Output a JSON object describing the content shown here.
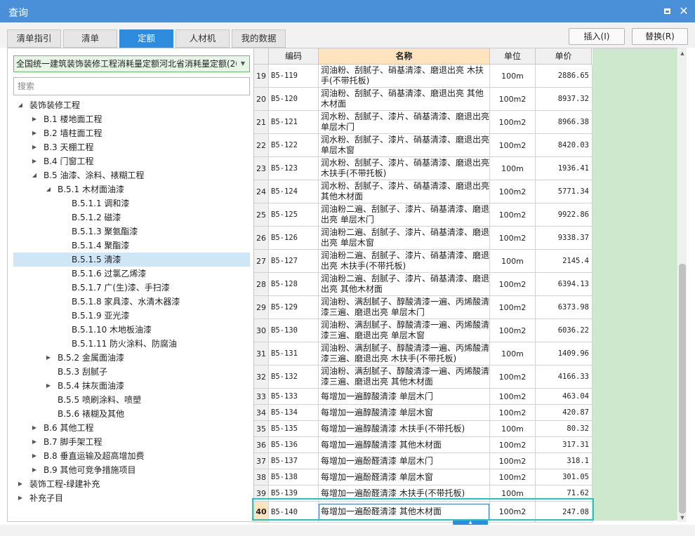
{
  "window": {
    "title": "查询"
  },
  "tabs": [
    "清单指引",
    "清单",
    "定额",
    "人材机",
    "我的数据"
  ],
  "active_tab": "定额",
  "buttons": {
    "insert": "插入(I)",
    "replace": "替换(R)"
  },
  "library_select": {
    "value": "全国统一建筑装饰装修工程消耗量定额河北省消耗量定额(20"
  },
  "search": {
    "placeholder": "搜索"
  },
  "tree": [
    "装饰装修工程",
    "B.1 楼地面工程",
    "B.2 墙柱面工程",
    "B.3 天棚工程",
    "B.4 门窗工程",
    "B.5 油漆、涂料、裱糊工程",
    "B.5.1 木材面油漆",
    "B.5.1.1 调和漆",
    "B.5.1.2 磁漆",
    "B.5.1.3 聚氨酯漆",
    "B.5.1.4 聚酯漆",
    "B.5.1.5 清漆",
    "B.5.1.6 过氯乙烯漆",
    "B.5.1.7 广(生)漆、手扫漆",
    "B.5.1.8 家具漆、水清木器漆",
    "B.5.1.9 亚光漆",
    "B.5.1.10 木地板油漆",
    "B.5.1.11 防火涂料、防腐油",
    "B.5.2 金属面油漆",
    "B.5.3 刮腻子",
    "B.5.4 抹灰面油漆",
    "B.5.5 喷刷涂料、喷塑",
    "B.5.6 裱糊及其他",
    "B.6 其他工程",
    "B.7 脚手架工程",
    "B.8 垂直运输及超高增加费",
    "B.9 其他可竞争措施项目",
    "装饰工程-绿建补充",
    "补充子目"
  ],
  "table": {
    "headers": [
      "编码",
      "名称",
      "单位",
      "单价"
    ],
    "rows": [
      {
        "no": "19",
        "code": "B5-119",
        "name": "润油粉、刮腻子、硝基清漆、磨退出亮 木扶手(不带托板)",
        "unit": "100m",
        "price": "2886.65"
      },
      {
        "no": "20",
        "code": "B5-120",
        "name": "润油粉、刮腻子、硝基清漆、磨退出亮 其他木材面",
        "unit": "100m2",
        "price": "8937.32"
      },
      {
        "no": "21",
        "code": "B5-121",
        "name": "润水粉、刮腻子、漆片、硝基清漆、磨退出亮 单层木门",
        "unit": "100m2",
        "price": "8966.38"
      },
      {
        "no": "22",
        "code": "B5-122",
        "name": "润水粉、刮腻子、漆片、硝基清漆、磨退出亮 单层木窗",
        "unit": "100m2",
        "price": "8420.03"
      },
      {
        "no": "23",
        "code": "B5-123",
        "name": "润水粉、刮腻子、漆片、硝基清漆、磨退出亮 木扶手(不带托板)",
        "unit": "100m",
        "price": "1936.41"
      },
      {
        "no": "24",
        "code": "B5-124",
        "name": "润水粉、刮腻子、漆片、硝基清漆、磨退出亮 其他木材面",
        "unit": "100m2",
        "price": "5771.34"
      },
      {
        "no": "25",
        "code": "B5-125",
        "name": "润油粉二遍、刮腻子、漆片、硝基清漆、磨退出亮 单层木门",
        "unit": "100m2",
        "price": "9922.86"
      },
      {
        "no": "26",
        "code": "B5-126",
        "name": "润油粉二遍、刮腻子、漆片、硝基清漆、磨退出亮 单层木窗",
        "unit": "100m2",
        "price": "9338.37"
      },
      {
        "no": "27",
        "code": "B5-127",
        "name": "润油粉二遍、刮腻子、漆片、硝基清漆、磨退出亮 木扶手(不带托板)",
        "unit": "100m",
        "price": "2145.4"
      },
      {
        "no": "28",
        "code": "B5-128",
        "name": "润油粉二遍、刮腻子、漆片、硝基清漆、磨退出亮 其他木材面",
        "unit": "100m2",
        "price": "6394.13"
      },
      {
        "no": "29",
        "code": "B5-129",
        "name": "润油粉、满刮腻子、醇酸清漆一遍、丙烯酸清漆三遍、磨退出亮 单层木门",
        "unit": "100m2",
        "price": "6373.98"
      },
      {
        "no": "30",
        "code": "B5-130",
        "name": "润油粉、满刮腻子、醇酸清漆一遍、丙烯酸清漆三遍、磨退出亮 单层木窗",
        "unit": "100m2",
        "price": "6036.22"
      },
      {
        "no": "31",
        "code": "B5-131",
        "name": "润油粉、满刮腻子、醇酸清漆一遍、丙烯酸清漆三遍、磨退出亮 木扶手(不带托板)",
        "unit": "100m",
        "price": "1409.96"
      },
      {
        "no": "32",
        "code": "B5-132",
        "name": "润油粉、满刮腻子、醇酸清漆一遍、丙烯酸清漆三遍、磨退出亮 其他木材面",
        "unit": "100m2",
        "price": "4166.33"
      },
      {
        "no": "33",
        "code": "B5-133",
        "name": "每增加一遍醇酸清漆 单层木门",
        "unit": "100m2",
        "price": "463.04"
      },
      {
        "no": "34",
        "code": "B5-134",
        "name": "每增加一遍醇酸清漆 单层木窗",
        "unit": "100m2",
        "price": "420.87"
      },
      {
        "no": "35",
        "code": "B5-135",
        "name": "每增加一遍醇酸清漆 木扶手(不带托板)",
        "unit": "100m",
        "price": "80.32"
      },
      {
        "no": "36",
        "code": "B5-136",
        "name": "每增加一遍醇酸清漆 其他木材面",
        "unit": "100m2",
        "price": "317.31"
      },
      {
        "no": "37",
        "code": "B5-137",
        "name": "每增加一遍酚醛清漆 单层木门",
        "unit": "100m2",
        "price": "318.1"
      },
      {
        "no": "38",
        "code": "B5-138",
        "name": "每增加一遍酚醛清漆 单层木窗",
        "unit": "100m2",
        "price": "301.05"
      },
      {
        "no": "39",
        "code": "B5-139",
        "name": "每增加一遍酚醛清漆 木扶手(不带托板)",
        "unit": "100m",
        "price": "71.62"
      },
      {
        "no": "40",
        "code": "B5-140",
        "name": "每增加一遍酚醛清漆 其他木材面",
        "unit": "100m2",
        "price": "247.08"
      }
    ],
    "selected_row": "40"
  },
  "colors": {
    "title_bar": "#4a90d9",
    "active_tab": "#2d8cdd",
    "selection_outline": "#22c5c5",
    "tree_selected": "#cfe6f7",
    "name_header": "#fde4bf",
    "green_area": "#cde8cd"
  }
}
